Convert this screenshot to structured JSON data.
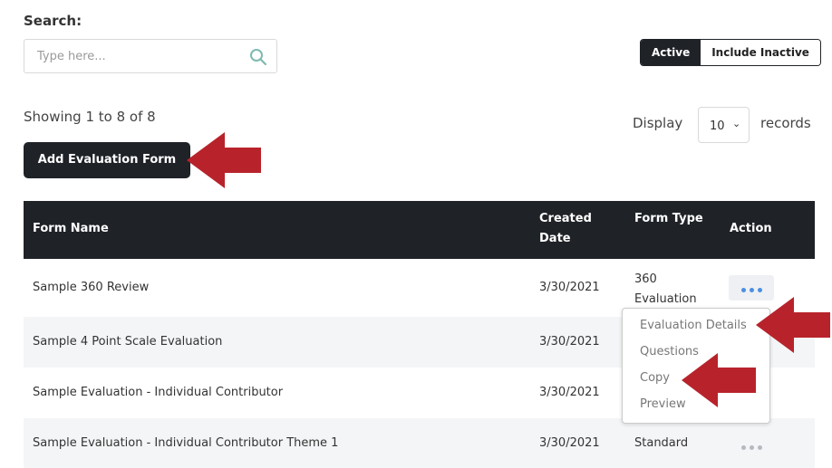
{
  "search": {
    "label": "Search:",
    "placeholder": "Type here..."
  },
  "filter": {
    "active_label": "Active",
    "inactive_label": "Include Inactive"
  },
  "summary": {
    "showing": "Showing 1 to 8 of 8"
  },
  "pagination": {
    "display_label": "Display",
    "page_size": "10",
    "records_label": "records"
  },
  "actions": {
    "add_label": "Add Evaluation Form"
  },
  "table": {
    "headers": {
      "form_name": "Form Name",
      "created_line1": "Created",
      "created_line2": "Date",
      "form_type": "Form Type",
      "action": "Action"
    },
    "rows": [
      {
        "name": "Sample 360 Review",
        "date": "3/30/2021",
        "type_line1": "360",
        "type_line2": "Evaluation"
      },
      {
        "name": "Sample 4 Point Scale Evaluation",
        "date": "3/30/2021",
        "type_line1": "",
        "type_line2": ""
      },
      {
        "name": "Sample Evaluation - Individual Contributor",
        "date": "3/30/2021",
        "type_line1": "",
        "type_line2": ""
      },
      {
        "name": "Sample Evaluation - Individual Contributor Theme 1",
        "date": "3/30/2021",
        "type_line1": "Standard",
        "type_line2": ""
      }
    ]
  },
  "action_menu": {
    "items": [
      "Evaluation Details",
      "Questions",
      "Copy",
      "Preview"
    ]
  },
  "colors": {
    "dark": "#1f2227",
    "arrow": "#b8232b",
    "dots_active": "#4a90e2",
    "dots_inactive": "#b5b9c0"
  }
}
